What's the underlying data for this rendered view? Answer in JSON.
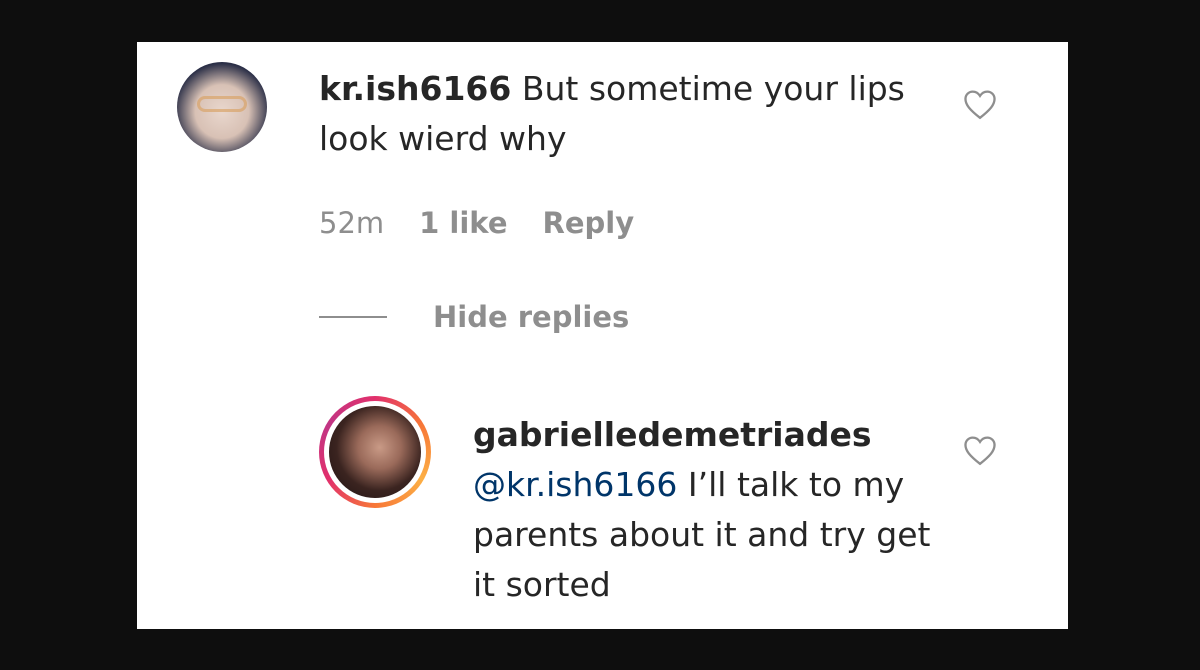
{
  "comment": {
    "username": "kr.ish6166",
    "text": " But sometime your lips look wierd why",
    "time": "52m",
    "likes": "1 like",
    "reply_label": "Reply",
    "avatar_icon": "avatar-icon",
    "like_icon": "heart-icon"
  },
  "hide_replies_label": "Hide replies",
  "reply": {
    "username": "gabrielledemetriades",
    "mention": "@kr.ish6166",
    "text": " I’ll talk to my parents about it and try get it sorted",
    "avatar_icon": "avatar-icon",
    "like_icon": "heart-icon"
  },
  "colors": {
    "background": "#0e0e0e",
    "card": "#ffffff",
    "text": "#262626",
    "secondary": "#8e8e8e",
    "mention": "#003569"
  }
}
